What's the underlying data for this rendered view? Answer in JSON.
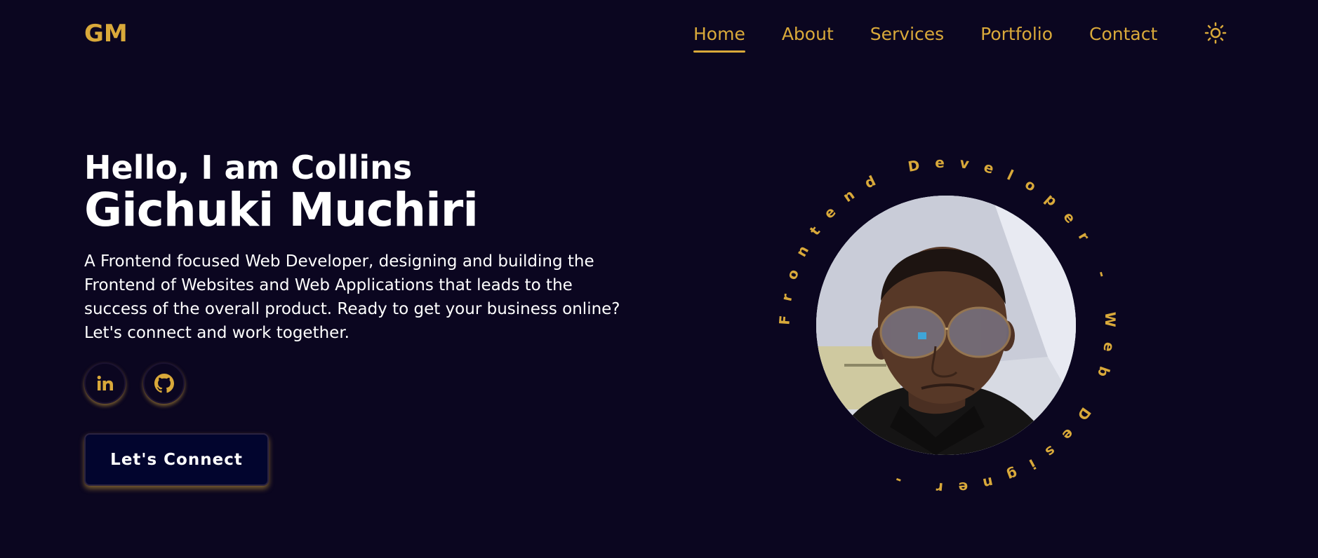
{
  "logo": "GM",
  "nav": {
    "items": [
      {
        "label": "Home",
        "active": true
      },
      {
        "label": "About",
        "active": false
      },
      {
        "label": "Services",
        "active": false
      },
      {
        "label": "Portfolio",
        "active": false
      },
      {
        "label": "Contact",
        "active": false
      }
    ],
    "theme_icon": "sun-icon"
  },
  "hero": {
    "greeting": "Hello, I am Collins",
    "name": "Gichuki Muchiri",
    "description": "A Frontend focused Web Developer, designing and building the Frontend of Websites and Web Applications that leads to the success of the overall product. Ready to get your business online? Let's connect and work together.",
    "socials": [
      {
        "name": "linkedin-icon"
      },
      {
        "name": "github-icon"
      }
    ],
    "cta_label": "Let's Connect"
  },
  "portrait": {
    "ring_text": "Frontend Developer - Web Designer - "
  },
  "colors": {
    "background": "#0b0620",
    "accent": "#d9a93a",
    "text": "#ffffff",
    "button_bg": "#02052e"
  }
}
